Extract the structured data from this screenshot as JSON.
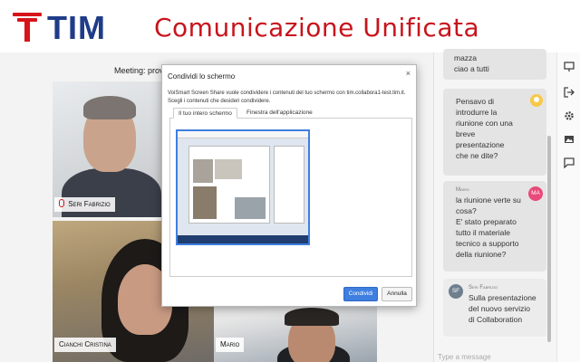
{
  "banner": {
    "logo_text": "TIM",
    "title": "Comunicazione Unificata",
    "brand_red": "#d7141a",
    "brand_blue": "#1f3c88"
  },
  "meeting": {
    "label": "Meeting: prova"
  },
  "participants": [
    {
      "name": "Seri Fabrizio",
      "muted": true
    },
    {
      "name": "Cianchi Cristina",
      "sharing": true
    },
    {
      "name": "Mario"
    }
  ],
  "share_dialog": {
    "title": "Condividi lo schermo",
    "close_icon": "×",
    "description": "VoiSmart Screen Share vuole condividere i contenuti del tuo schermo con tim.collabora1-test.tim.it. Scegli i contenuti che desideri condividere.",
    "tabs": [
      {
        "label": "Il tuo intero schermo",
        "active": true
      },
      {
        "label": "Finestra dell'applicazione",
        "active": false
      }
    ],
    "share_button": "Condividi",
    "cancel_button": "Annulla",
    "accent": "#3f7fe0"
  },
  "chat": {
    "messages": [
      {
        "sender": "",
        "text_lines": [
          "mazza",
          "ciao a tutti"
        ],
        "avatar": ""
      },
      {
        "sender": "",
        "text_lines": [
          "Pensavo di",
          "introdurre la",
          "riunione con una",
          "breve",
          "presentazione",
          "che ne dite?"
        ],
        "avatar": "user-icon"
      },
      {
        "sender": "Mario",
        "text_lines": [
          "la riunione verte su",
          "cosa?",
          "E' stato preparato",
          "tutto il materiale",
          "tecnico a supporto",
          "della riunione?"
        ],
        "avatar": "MA"
      },
      {
        "sender": "Seri Fabrizio",
        "text_lines": [
          "Sulla presentazione",
          "del nuovo servizio",
          "di Collaboration"
        ],
        "avatar": "SF"
      }
    ],
    "input_placeholder": "Type a message"
  },
  "toolbar": {
    "icons": [
      "presentation-icon",
      "exit-icon",
      "gear-icon",
      "image-icon",
      "chat-icon"
    ]
  }
}
